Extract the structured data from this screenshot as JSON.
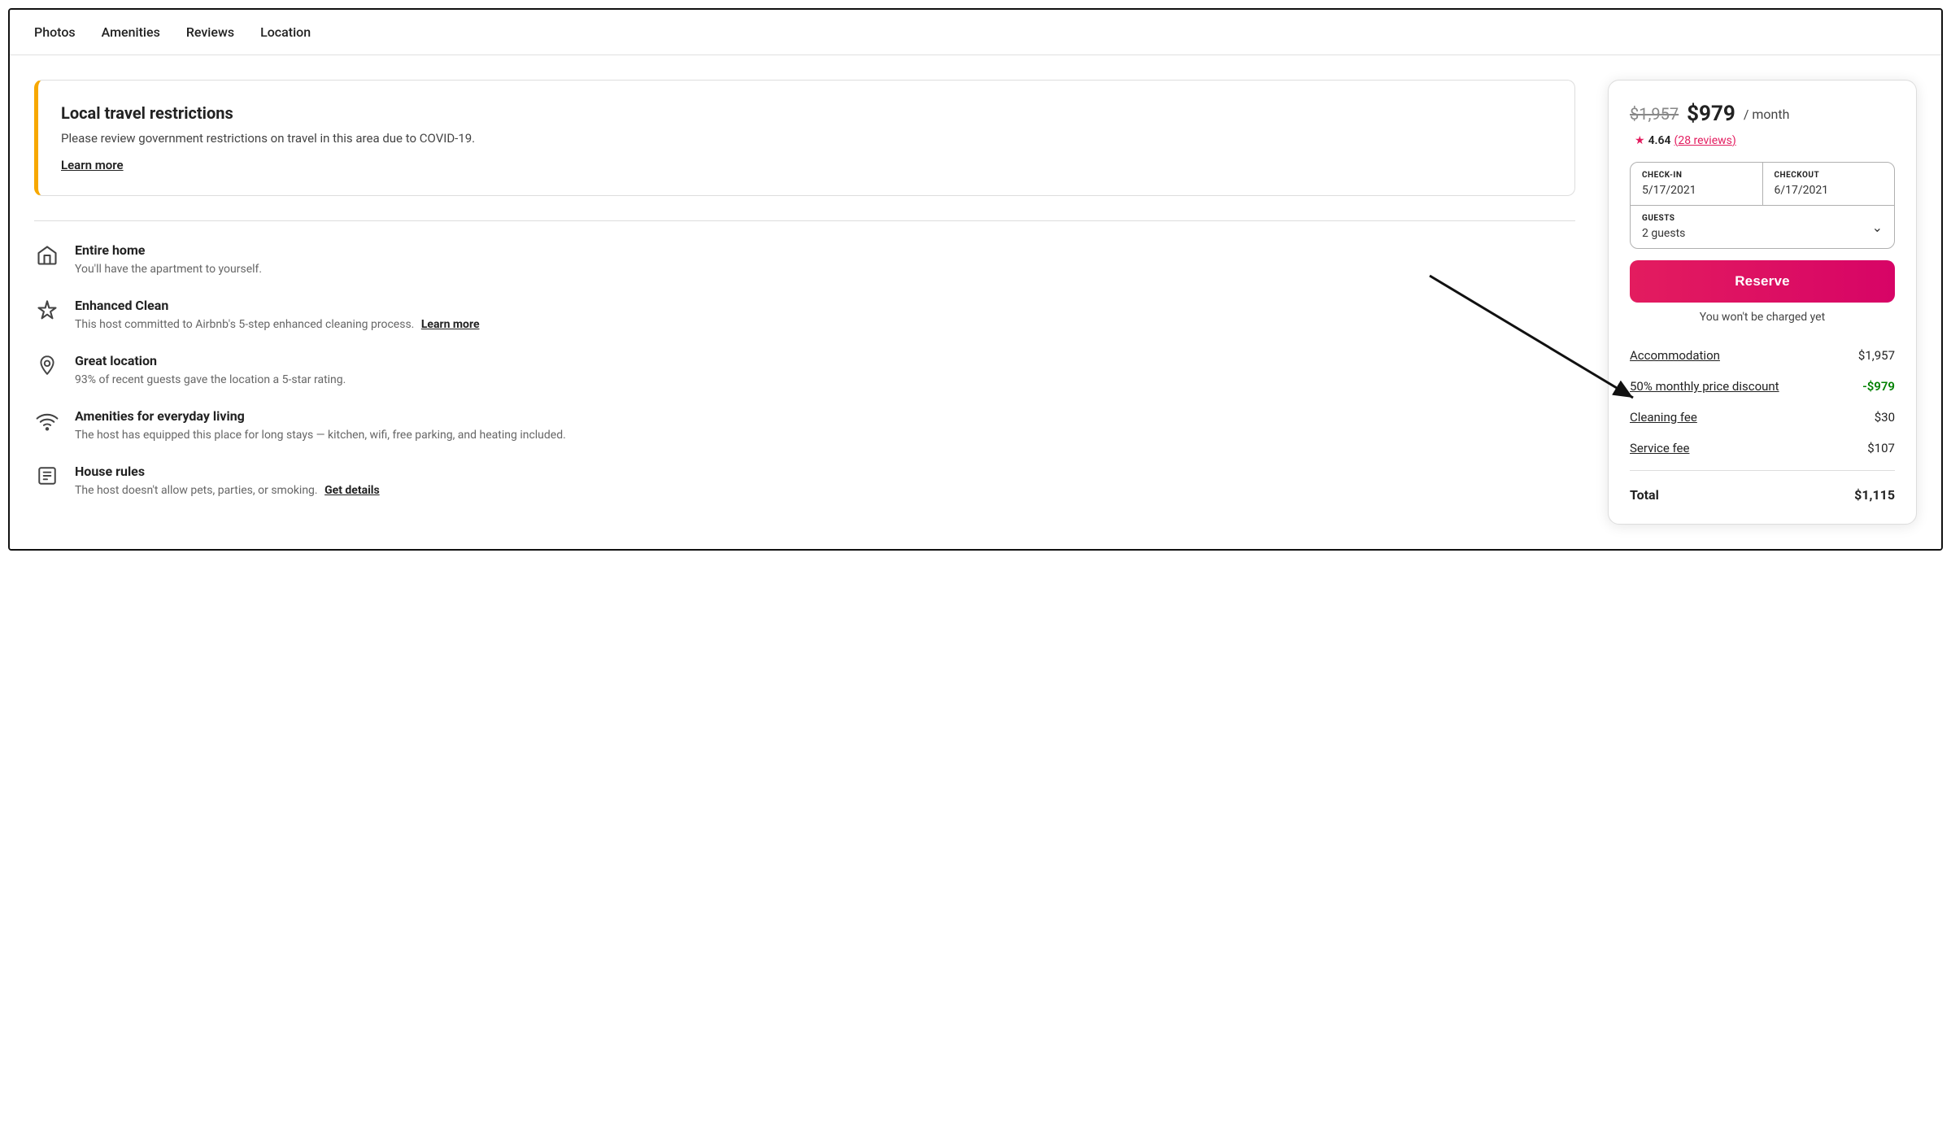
{
  "nav": {
    "items": [
      {
        "label": "Photos",
        "id": "photos"
      },
      {
        "label": "Amenities",
        "id": "amenities"
      },
      {
        "label": "Reviews",
        "id": "reviews"
      },
      {
        "label": "Location",
        "id": "location"
      }
    ]
  },
  "restriction_banner": {
    "title": "Local travel restrictions",
    "description": "Please review government restrictions on travel in this area due to COVID-19.",
    "learn_more_label": "Learn more"
  },
  "features": [
    {
      "icon": "🏠",
      "icon_name": "home-icon",
      "title": "Entire home",
      "description": "You'll have the apartment to yourself.",
      "link": null
    },
    {
      "icon": "✦",
      "icon_name": "sparkle-icon",
      "title": "Enhanced Clean",
      "description": "This host committed to Airbnb's 5-step enhanced cleaning process.",
      "link": "Learn more"
    },
    {
      "icon": "📍",
      "icon_name": "location-pin-icon",
      "title": "Great location",
      "description": "93% of recent guests gave the location a 5-star rating.",
      "link": null
    },
    {
      "icon": "📶",
      "icon_name": "wifi-icon",
      "title": "Amenities for everyday living",
      "description": "The host has equipped this place for long stays — kitchen, wifi, free parking, and heating included.",
      "link": null
    },
    {
      "icon": "📋",
      "icon_name": "rules-icon",
      "title": "House rules",
      "description": "The host doesn't allow pets, parties, or smoking.",
      "link": "Get details"
    }
  ],
  "booking_card": {
    "price_original": "$1,957",
    "price_discounted": "$979",
    "price_per_month": "/ month",
    "rating": "4.64",
    "reviews_count": "28 reviews",
    "checkin_label": "CHECK-IN",
    "checkin_value": "5/17/2021",
    "checkout_label": "CHECKOUT",
    "checkout_value": "6/17/2021",
    "guests_label": "GUESTS",
    "guests_value": "2 guests",
    "reserve_label": "Reserve",
    "no_charge_text": "You won't be charged yet",
    "breakdown": {
      "accommodation_label": "Accommodation",
      "accommodation_amount": "$1,957",
      "discount_label": "50% monthly price discount",
      "discount_amount": "-$979",
      "cleaning_label": "Cleaning fee",
      "cleaning_amount": "$30",
      "service_label": "Service fee",
      "service_amount": "$107",
      "total_label": "Total",
      "total_amount": "$1,115"
    }
  }
}
